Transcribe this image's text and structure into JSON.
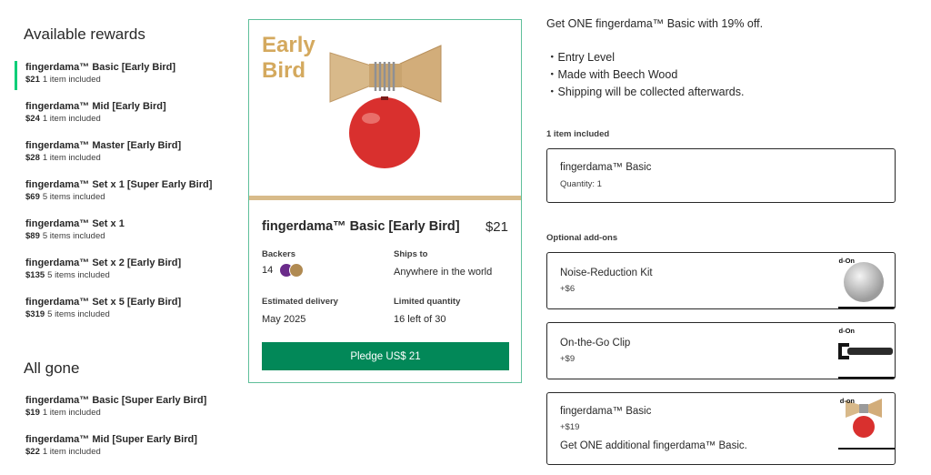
{
  "sidebar": {
    "available_title": "Available rewards",
    "available": [
      {
        "name": "fingerdama™ Basic [Early Bird]",
        "price": "$21",
        "items": "1 item included"
      },
      {
        "name": "fingerdama™ Mid [Early Bird]",
        "price": "$24",
        "items": "1 item included"
      },
      {
        "name": "fingerdama™ Master [Early Bird]",
        "price": "$28",
        "items": "1 item included"
      },
      {
        "name": "fingerdama™ Set x 1 [Super Early Bird]",
        "price": "$69",
        "items": "5 items included"
      },
      {
        "name": "fingerdama™ Set x 1",
        "price": "$89",
        "items": "5 items included"
      },
      {
        "name": "fingerdama™ Set x 2 [Early Bird]",
        "price": "$135",
        "items": "5 items included"
      },
      {
        "name": "fingerdama™ Set x 5 [Early Bird]",
        "price": "$319",
        "items": "5 items included"
      }
    ],
    "gone_title": "All gone",
    "gone": [
      {
        "name": "fingerdama™ Basic [Super Early Bird]",
        "price": "$19",
        "items": "1 item included"
      },
      {
        "name": "fingerdama™ Mid [Super Early Bird]",
        "price": "$22",
        "items": "1 item included"
      }
    ]
  },
  "card": {
    "image_text_line1": "Early",
    "image_text_line2": "Bird",
    "title": "fingerdama™ Basic [Early Bird]",
    "price": "$21",
    "backers_label": "Backers",
    "backers_count": "14",
    "ships_label": "Ships to",
    "ships_value": "Anywhere in the world",
    "delivery_label": "Estimated delivery",
    "delivery_value": "May 2025",
    "limited_label": "Limited quantity",
    "limited_value": "16 left of 30",
    "pledge_button": "Pledge US$ 21"
  },
  "details": {
    "description": "Get ONE fingerdama™ Basic with 19% off.",
    "bullets": [
      "・Entry Level",
      "・Made with Beech Wood",
      "・Shipping will be collected afterwards."
    ],
    "included_label": "1 item included",
    "included_item": {
      "name": "fingerdama™ Basic",
      "quantity": "Quantity: 1"
    },
    "addons_label": "Optional add-ons",
    "addons": [
      {
        "name": "Noise-Reduction Kit",
        "price": "+$6",
        "tag": "d-On"
      },
      {
        "name": "On-the-Go Clip",
        "price": "+$9",
        "tag": "d-On"
      },
      {
        "name": "fingerdama™ Basic",
        "price": "+$19",
        "tag": "d-on",
        "note": "Get ONE additional fingerdama™ Basic."
      }
    ]
  },
  "colors": {
    "accent_green": "#05ce78",
    "button_green": "#028858",
    "card_border": "#5fbf9a",
    "early_bird_gold": "#d4a95e",
    "ball_red": "#d9302e"
  }
}
